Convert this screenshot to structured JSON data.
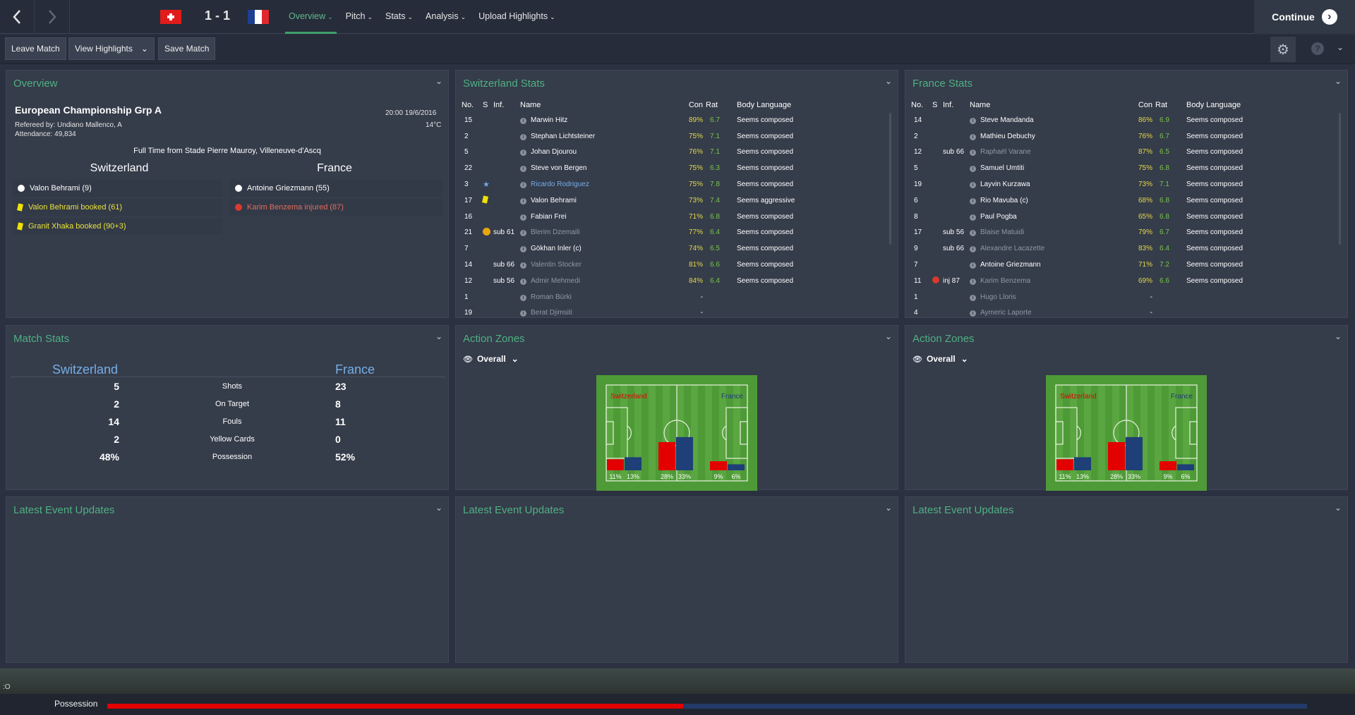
{
  "header": {
    "score": "1 - 1",
    "home_flag": "switzerland-flag",
    "away_flag": "france-flag",
    "tabs": [
      {
        "label": "Overview",
        "active": true
      },
      {
        "label": "Pitch"
      },
      {
        "label": "Stats"
      },
      {
        "label": "Analysis"
      },
      {
        "label": "Upload Highlights"
      }
    ],
    "continue_label": "Continue"
  },
  "toolbar": {
    "leave_match": "Leave Match",
    "view_highlights": "View Highlights",
    "save_match": "Save Match"
  },
  "overview": {
    "title": "Overview",
    "competition": "European Championship Grp A",
    "datetime": "20:00 19/6/2016",
    "referee": "Refereed by: Undiano Mallenco, A",
    "temperature": "14°C",
    "attendance": "Attendance: 49,834",
    "result": "Full Time from Stade Pierre Mauroy, Villeneuve-d'Ascq",
    "home_team": "Switzerland",
    "away_team": "France",
    "home_events": [
      {
        "text": "Valon Behrami (9)",
        "type": "goal"
      },
      {
        "text": "Valon Behrami booked (61)",
        "type": "yellow"
      },
      {
        "text": "Granit Xhaka booked (90+3)",
        "type": "yellow"
      }
    ],
    "away_events": [
      {
        "text": "Antoine Griezmann (55)",
        "type": "goal"
      },
      {
        "text": "Karim Benzema injured (87)",
        "type": "injury"
      }
    ]
  },
  "swiss_stats": {
    "title": "Switzerland Stats",
    "headers": [
      "No.",
      "S",
      "Inf.",
      "Name",
      "Con",
      "Rat",
      "Body Language"
    ],
    "rows": [
      {
        "no": "15",
        "s": "",
        "inf": "",
        "name": "Marwin Hitz",
        "con": "89%",
        "rat": "6.7",
        "body": "Seems composed",
        "style": ""
      },
      {
        "no": "2",
        "s": "",
        "inf": "",
        "name": "Stephan Lichtsteiner",
        "con": "75%",
        "rat": "7.1",
        "body": "Seems composed",
        "style": ""
      },
      {
        "no": "5",
        "s": "",
        "inf": "",
        "name": "Johan Djourou",
        "con": "76%",
        "rat": "7.1",
        "body": "Seems composed",
        "style": ""
      },
      {
        "no": "22",
        "s": "",
        "inf": "",
        "name": "Steve von Bergen",
        "con": "75%",
        "rat": "6.3",
        "body": "Seems composed",
        "style": ""
      },
      {
        "no": "3",
        "s": "star",
        "inf": "",
        "name": "Ricardo Rodriguez",
        "con": "75%",
        "rat": "7.8",
        "body": "Seems composed",
        "style": "star"
      },
      {
        "no": "17",
        "s": "yellow",
        "inf": "",
        "name": "Valon Behrami",
        "con": "73%",
        "rat": "7.4",
        "body": "Seems aggressive",
        "style": ""
      },
      {
        "no": "16",
        "s": "",
        "inf": "",
        "name": "Fabian Frei",
        "con": "71%",
        "rat": "6.8",
        "body": "Seems composed",
        "style": ""
      },
      {
        "no": "21",
        "s": "sub-icon",
        "inf": "sub 61",
        "name": "Blerim Dzemaili",
        "con": "77%",
        "rat": "6.4",
        "body": "Seems composed",
        "style": "dim"
      },
      {
        "no": "7",
        "s": "",
        "inf": "",
        "name": "Gökhan Inler (c)",
        "con": "74%",
        "rat": "6.5",
        "body": "Seems composed",
        "style": ""
      },
      {
        "no": "14",
        "s": "",
        "inf": "sub 66",
        "name": "Valentin Stocker",
        "con": "81%",
        "rat": "6.6",
        "body": "Seems composed",
        "style": "dim"
      },
      {
        "no": "12",
        "s": "",
        "inf": "sub 56",
        "name": "Admir Mehmedi",
        "con": "84%",
        "rat": "6.4",
        "body": "Seems composed",
        "style": "dim"
      },
      {
        "no": "1",
        "s": "",
        "inf": "",
        "name": "Roman Bürki",
        "con": "-",
        "rat": "",
        "body": "",
        "style": "dim"
      },
      {
        "no": "19",
        "s": "",
        "inf": "",
        "name": "Berat Djimsiti",
        "con": "-",
        "rat": "",
        "body": "",
        "style": "dim"
      }
    ]
  },
  "france_stats": {
    "title": "France Stats",
    "headers": [
      "No.",
      "S",
      "Inf.",
      "Name",
      "Con",
      "Rat",
      "Body Language"
    ],
    "rows": [
      {
        "no": "14",
        "s": "",
        "inf": "",
        "name": "Steve Mandanda",
        "con": "86%",
        "rat": "6.9",
        "body": "Seems composed",
        "style": ""
      },
      {
        "no": "2",
        "s": "",
        "inf": "",
        "name": "Mathieu Debuchy",
        "con": "76%",
        "rat": "6.7",
        "body": "Seems composed",
        "style": ""
      },
      {
        "no": "12",
        "s": "",
        "inf": "sub 66",
        "name": "Raphaël Varane",
        "con": "87%",
        "rat": "6.5",
        "body": "Seems composed",
        "style": "dim"
      },
      {
        "no": "5",
        "s": "",
        "inf": "",
        "name": "Samuel Umtiti",
        "con": "75%",
        "rat": "6.8",
        "body": "Seems composed",
        "style": ""
      },
      {
        "no": "19",
        "s": "",
        "inf": "",
        "name": "Layvin Kurzawa",
        "con": "73%",
        "rat": "7.1",
        "body": "Seems composed",
        "style": ""
      },
      {
        "no": "6",
        "s": "",
        "inf": "",
        "name": "Rio Mavuba (c)",
        "con": "68%",
        "rat": "6.8",
        "body": "Seems composed",
        "style": ""
      },
      {
        "no": "8",
        "s": "",
        "inf": "",
        "name": "Paul Pogba",
        "con": "65%",
        "rat": "6.8",
        "body": "Seems composed",
        "style": ""
      },
      {
        "no": "17",
        "s": "",
        "inf": "sub 56",
        "name": "Blaise Matuidi",
        "con": "79%",
        "rat": "6.7",
        "body": "Seems composed",
        "style": "dim"
      },
      {
        "no": "9",
        "s": "",
        "inf": "sub 66",
        "name": "Alexandre Lacazette",
        "con": "83%",
        "rat": "6.4",
        "body": "Seems composed",
        "style": "dim"
      },
      {
        "no": "7",
        "s": "",
        "inf": "",
        "name": "Antoine Griezmann",
        "con": "71%",
        "rat": "7.2",
        "body": "Seems composed",
        "style": ""
      },
      {
        "no": "11",
        "s": "injury",
        "inf": "inj 87",
        "name": "Karim Benzema",
        "con": "69%",
        "rat": "6.6",
        "body": "Seems composed",
        "style": "dim"
      },
      {
        "no": "1",
        "s": "",
        "inf": "",
        "name": "Hugo Lloris",
        "con": "-",
        "rat": "",
        "body": "",
        "style": "dim"
      },
      {
        "no": "4",
        "s": "",
        "inf": "",
        "name": "Aymeric Laporte",
        "con": "-",
        "rat": "",
        "body": "",
        "style": "dim"
      }
    ]
  },
  "match_stats": {
    "title": "Match Stats",
    "home_team": "Switzerland",
    "away_team": "France",
    "rows": [
      {
        "label": "Shots",
        "home": "5",
        "away": "23"
      },
      {
        "label": "On Target",
        "home": "2",
        "away": "8"
      },
      {
        "label": "Fouls",
        "home": "14",
        "away": "11"
      },
      {
        "label": "Yellow Cards",
        "home": "2",
        "away": "0"
      },
      {
        "label": "Possession",
        "home": "48%",
        "away": "52%"
      }
    ]
  },
  "action_zones": [
    {
      "title": "Action Zones",
      "filter": "Overall",
      "home_label": "Switzerland",
      "away_label": "France",
      "zones": [
        {
          "home": "11%",
          "away": "13%",
          "home_v": 11,
          "away_v": 13
        },
        {
          "home": "28%",
          "away": "33%",
          "home_v": 28,
          "away_v": 33
        },
        {
          "home": "9%",
          "away": "6%",
          "home_v": 9,
          "away_v": 6
        }
      ]
    },
    {
      "title": "Action Zones",
      "filter": "Overall",
      "home_label": "Switzerland",
      "away_label": "France",
      "zones": [
        {
          "home": "11%",
          "away": "13%",
          "home_v": 11,
          "away_v": 13
        },
        {
          "home": "28%",
          "away": "33%",
          "home_v": 28,
          "away_v": 33
        },
        {
          "home": "9%",
          "away": "6%",
          "home_v": 9,
          "away_v": 6
        }
      ]
    }
  ],
  "latest_events": {
    "title": "Latest Event Updates"
  },
  "footer": {
    "possession_label": "Possession",
    "home_possession": 48,
    "tiny_text": ":O"
  },
  "colors": {
    "accent_green": "#4fb183",
    "home_red": "#e30000",
    "away_blue": "#233a68",
    "con_yellow": "#e4d94a",
    "rat_green": "#79c64a"
  }
}
